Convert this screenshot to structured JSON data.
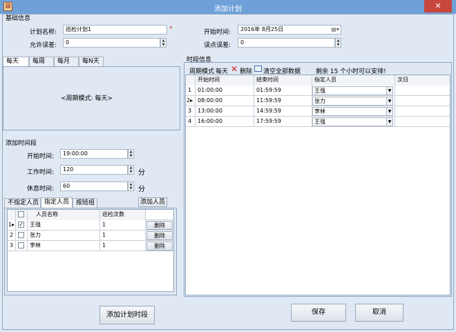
{
  "window": {
    "title": "添加计划",
    "close_glyph": "✕",
    "app_icon": "planner-app-icon"
  },
  "basic": {
    "group_label": "基础信息",
    "plan_name_label": "计划名称:",
    "plan_name_value": "巡检计划1",
    "required_mark": "*",
    "allow_error_label": "允许误差:",
    "allow_error_value": "0",
    "start_time_label": "开始时间:",
    "start_time_value": "2016年  8月25日",
    "error_point_label": "误点误差:",
    "error_point_value": "0"
  },
  "period_tabs": [
    "每天",
    "每周",
    "每月",
    "每N天"
  ],
  "period_mode_text": "<周期模式: 每天>",
  "add_segment": {
    "group_label": "添加时间段",
    "start_label": "开始时间:",
    "start_value": "19:00:00",
    "work_label": "工作时间:",
    "work_value": "120",
    "work_unit": "分",
    "rest_label": "休息时间:",
    "rest_value": "60",
    "rest_unit": "分"
  },
  "person_tabs": [
    "不指定人员",
    "指定人员",
    "按班组"
  ],
  "add_person_label": "添加人员",
  "persons": {
    "headers": [
      "人员名称",
      "巡检次数"
    ],
    "delete_label": "删除",
    "rows": [
      {
        "num": "1",
        "checked": true,
        "name": "王强",
        "count": "1"
      },
      {
        "num": "2",
        "checked": false,
        "name": "张力",
        "count": "1"
      },
      {
        "num": "3",
        "checked": false,
        "name": "李林",
        "count": "1"
      }
    ]
  },
  "add_segment_button": "添加计划时段",
  "segments": {
    "group_label": "时段信息",
    "toolbar": {
      "mode_label": "周期模式",
      "mode_value": "每天",
      "delete_label": "删除",
      "clear_label": "清空全部数据",
      "remaining": "剩余 15 个小时可以安排!"
    },
    "headers": [
      "开始时间",
      "结束时间",
      "指定人员",
      "次日"
    ],
    "rows": [
      {
        "num": "1",
        "start": "01:00:00",
        "end": "01:59:59",
        "person": "王强"
      },
      {
        "num": "2",
        "start": "08:00:00",
        "end": "11:59:59",
        "person": "张力"
      },
      {
        "num": "3",
        "start": "13:00:00",
        "end": "14:59:59",
        "person": "李林"
      },
      {
        "num": "4",
        "start": "16:00:00",
        "end": "17:59:59",
        "person": "王强"
      }
    ]
  },
  "save_label": "保存",
  "cancel_label": "取消",
  "colors": {
    "titlebar": "#6fa0d8",
    "close": "#c9463d",
    "background": "#dfe8f3",
    "delete_icon": "#d02020"
  }
}
